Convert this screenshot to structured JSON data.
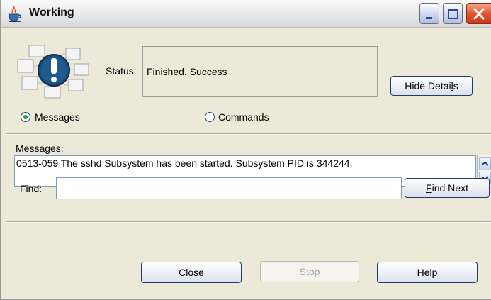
{
  "window": {
    "title": "Working",
    "controls": [
      "minimize",
      "maximize",
      "close"
    ]
  },
  "status": {
    "label": "Status:",
    "value": "Finished.  Success"
  },
  "details_button": {
    "label_before": "Hide Detai",
    "label_mnemonic": "l",
    "label_after": "s"
  },
  "view_options": {
    "messages_label": "Messages",
    "commands_label": "Commands",
    "selected": "Messages"
  },
  "messages": {
    "heading": "Messages:",
    "text": "0513-059 The sshd Subsystem has been started. Subsystem PID is 344244."
  },
  "find": {
    "label": "Find:",
    "value": "",
    "button_mnemonic": "F",
    "button_rest": "ind Next"
  },
  "footer": {
    "close_mnemonic": "C",
    "close_rest": "lose",
    "stop_label": "Stop",
    "help_mnemonic": "H",
    "help_rest": "elp"
  },
  "colors": {
    "window_bg": "#ece9d8",
    "radio_selected": "#21a121",
    "close_button_red": "#e2522b",
    "info_icon_blue": "#1c4f80"
  },
  "icons": {
    "title": "java-cup-icon",
    "status": "info-exclamation-icon"
  }
}
